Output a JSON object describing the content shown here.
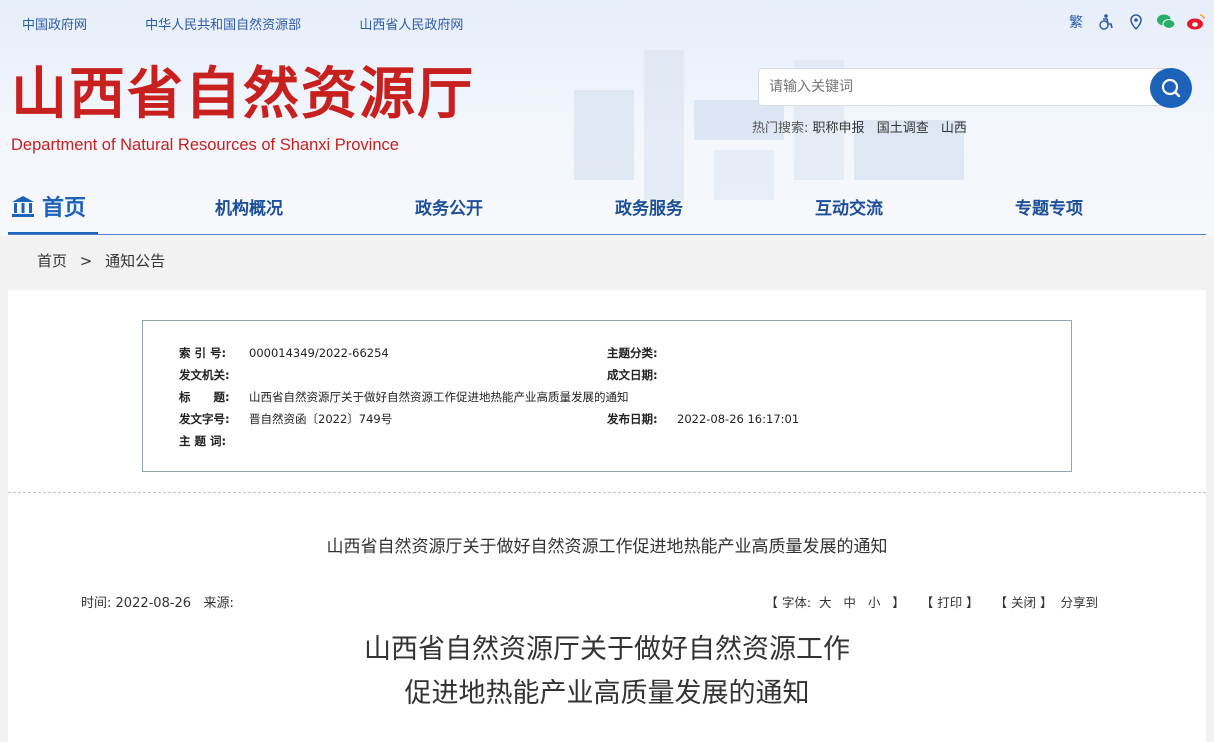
{
  "top_links": [
    "中国政府网",
    "中华人民共和国自然资源部",
    "山西省人民政府网"
  ],
  "top_icons": {
    "traditional_label": "繁",
    "accessibility": "accessibility-icon",
    "location": "location-icon",
    "wechat": "wechat-icon",
    "weibo": "weibo-icon"
  },
  "logo": {
    "cn": "山西省自然资源厅",
    "en": "Department of Natural Resources of Shanxi Province"
  },
  "search": {
    "placeholder": "请输入关键词",
    "hot_label": "热门搜索:",
    "hot_keywords": [
      "职称申报",
      "国土调查",
      "山西"
    ]
  },
  "nav": {
    "home": "首页",
    "items": [
      "机构概况",
      "政务公开",
      "政务服务",
      "互动交流",
      "专题专项"
    ]
  },
  "breadcrumb": {
    "home": "首页",
    "separator": ">",
    "current": "通知公告"
  },
  "meta": {
    "index_label": "索 引 号:",
    "index_value": "000014349/2022-66254",
    "topic_label": "主题分类:",
    "topic_value": "",
    "issuer_label": "发文机关:",
    "issuer_value": "",
    "date_label": "成文日期:",
    "date_value": "",
    "title_label": "标　　题:",
    "title_value": "山西省自然资源厅关于做好自然资源工作促进地热能产业高质量发展的通知",
    "docno_label": "发文字号:",
    "docno_value": "晋自然资函〔2022〕749号",
    "publish_label": "发布日期:",
    "publish_value": "2022-08-26 16:17:01",
    "keywords_label": "主 题 词:",
    "keywords_value": ""
  },
  "article": {
    "title": "山西省自然资源厅关于做好自然资源工作促进地热能产业高质量发展的通知",
    "time_label": "时间:",
    "time_value": "2022-08-26",
    "source_label": "来源:",
    "source_value": "",
    "font_label": "【 字体:",
    "font_large": "大",
    "font_medium": "中",
    "font_small": "小",
    "font_close": "】",
    "print": "【 打印 】",
    "close": "【 关闭 】",
    "share": "分享到",
    "big_title_line1": "山西省自然资源厅关于做好自然资源工作",
    "big_title_line2": "促进地热能产业高质量发展的通知"
  },
  "colors": {
    "brand_red": "#c8201e",
    "nav_blue": "#1b4f9a",
    "accent_blue": "#1b62b8"
  }
}
